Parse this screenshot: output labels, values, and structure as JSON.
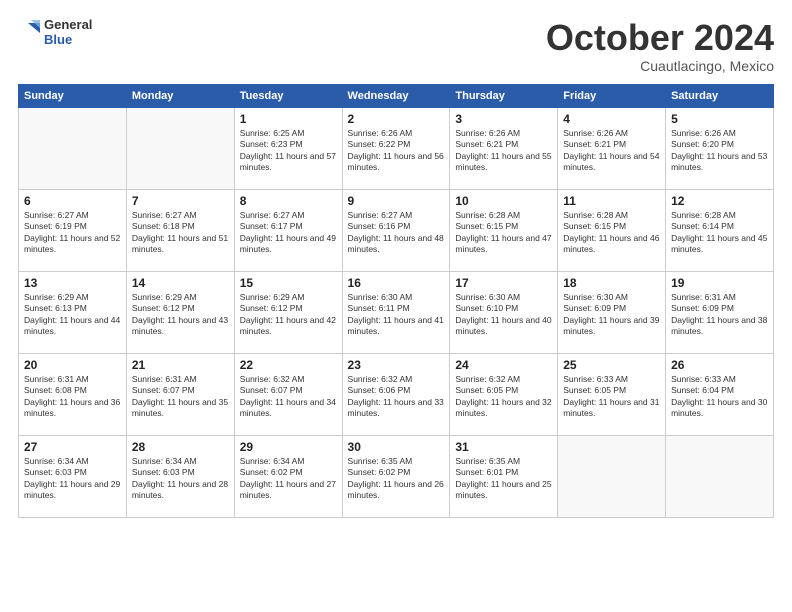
{
  "header": {
    "logo_line1": "General",
    "logo_line2": "Blue",
    "month": "October 2024",
    "location": "Cuautlacingo, Mexico"
  },
  "weekdays": [
    "Sunday",
    "Monday",
    "Tuesday",
    "Wednesday",
    "Thursday",
    "Friday",
    "Saturday"
  ],
  "weeks": [
    [
      {
        "day": "",
        "sunrise": "",
        "sunset": "",
        "daylight": ""
      },
      {
        "day": "",
        "sunrise": "",
        "sunset": "",
        "daylight": ""
      },
      {
        "day": "1",
        "sunrise": "Sunrise: 6:25 AM",
        "sunset": "Sunset: 6:23 PM",
        "daylight": "Daylight: 11 hours and 57 minutes."
      },
      {
        "day": "2",
        "sunrise": "Sunrise: 6:26 AM",
        "sunset": "Sunset: 6:22 PM",
        "daylight": "Daylight: 11 hours and 56 minutes."
      },
      {
        "day": "3",
        "sunrise": "Sunrise: 6:26 AM",
        "sunset": "Sunset: 6:21 PM",
        "daylight": "Daylight: 11 hours and 55 minutes."
      },
      {
        "day": "4",
        "sunrise": "Sunrise: 6:26 AM",
        "sunset": "Sunset: 6:21 PM",
        "daylight": "Daylight: 11 hours and 54 minutes."
      },
      {
        "day": "5",
        "sunrise": "Sunrise: 6:26 AM",
        "sunset": "Sunset: 6:20 PM",
        "daylight": "Daylight: 11 hours and 53 minutes."
      }
    ],
    [
      {
        "day": "6",
        "sunrise": "Sunrise: 6:27 AM",
        "sunset": "Sunset: 6:19 PM",
        "daylight": "Daylight: 11 hours and 52 minutes."
      },
      {
        "day": "7",
        "sunrise": "Sunrise: 6:27 AM",
        "sunset": "Sunset: 6:18 PM",
        "daylight": "Daylight: 11 hours and 51 minutes."
      },
      {
        "day": "8",
        "sunrise": "Sunrise: 6:27 AM",
        "sunset": "Sunset: 6:17 PM",
        "daylight": "Daylight: 11 hours and 49 minutes."
      },
      {
        "day": "9",
        "sunrise": "Sunrise: 6:27 AM",
        "sunset": "Sunset: 6:16 PM",
        "daylight": "Daylight: 11 hours and 48 minutes."
      },
      {
        "day": "10",
        "sunrise": "Sunrise: 6:28 AM",
        "sunset": "Sunset: 6:15 PM",
        "daylight": "Daylight: 11 hours and 47 minutes."
      },
      {
        "day": "11",
        "sunrise": "Sunrise: 6:28 AM",
        "sunset": "Sunset: 6:15 PM",
        "daylight": "Daylight: 11 hours and 46 minutes."
      },
      {
        "day": "12",
        "sunrise": "Sunrise: 6:28 AM",
        "sunset": "Sunset: 6:14 PM",
        "daylight": "Daylight: 11 hours and 45 minutes."
      }
    ],
    [
      {
        "day": "13",
        "sunrise": "Sunrise: 6:29 AM",
        "sunset": "Sunset: 6:13 PM",
        "daylight": "Daylight: 11 hours and 44 minutes."
      },
      {
        "day": "14",
        "sunrise": "Sunrise: 6:29 AM",
        "sunset": "Sunset: 6:12 PM",
        "daylight": "Daylight: 11 hours and 43 minutes."
      },
      {
        "day": "15",
        "sunrise": "Sunrise: 6:29 AM",
        "sunset": "Sunset: 6:12 PM",
        "daylight": "Daylight: 11 hours and 42 minutes."
      },
      {
        "day": "16",
        "sunrise": "Sunrise: 6:30 AM",
        "sunset": "Sunset: 6:11 PM",
        "daylight": "Daylight: 11 hours and 41 minutes."
      },
      {
        "day": "17",
        "sunrise": "Sunrise: 6:30 AM",
        "sunset": "Sunset: 6:10 PM",
        "daylight": "Daylight: 11 hours and 40 minutes."
      },
      {
        "day": "18",
        "sunrise": "Sunrise: 6:30 AM",
        "sunset": "Sunset: 6:09 PM",
        "daylight": "Daylight: 11 hours and 39 minutes."
      },
      {
        "day": "19",
        "sunrise": "Sunrise: 6:31 AM",
        "sunset": "Sunset: 6:09 PM",
        "daylight": "Daylight: 11 hours and 38 minutes."
      }
    ],
    [
      {
        "day": "20",
        "sunrise": "Sunrise: 6:31 AM",
        "sunset": "Sunset: 6:08 PM",
        "daylight": "Daylight: 11 hours and 36 minutes."
      },
      {
        "day": "21",
        "sunrise": "Sunrise: 6:31 AM",
        "sunset": "Sunset: 6:07 PM",
        "daylight": "Daylight: 11 hours and 35 minutes."
      },
      {
        "day": "22",
        "sunrise": "Sunrise: 6:32 AM",
        "sunset": "Sunset: 6:07 PM",
        "daylight": "Daylight: 11 hours and 34 minutes."
      },
      {
        "day": "23",
        "sunrise": "Sunrise: 6:32 AM",
        "sunset": "Sunset: 6:06 PM",
        "daylight": "Daylight: 11 hours and 33 minutes."
      },
      {
        "day": "24",
        "sunrise": "Sunrise: 6:32 AM",
        "sunset": "Sunset: 6:05 PM",
        "daylight": "Daylight: 11 hours and 32 minutes."
      },
      {
        "day": "25",
        "sunrise": "Sunrise: 6:33 AM",
        "sunset": "Sunset: 6:05 PM",
        "daylight": "Daylight: 11 hours and 31 minutes."
      },
      {
        "day": "26",
        "sunrise": "Sunrise: 6:33 AM",
        "sunset": "Sunset: 6:04 PM",
        "daylight": "Daylight: 11 hours and 30 minutes."
      }
    ],
    [
      {
        "day": "27",
        "sunrise": "Sunrise: 6:34 AM",
        "sunset": "Sunset: 6:03 PM",
        "daylight": "Daylight: 11 hours and 29 minutes."
      },
      {
        "day": "28",
        "sunrise": "Sunrise: 6:34 AM",
        "sunset": "Sunset: 6:03 PM",
        "daylight": "Daylight: 11 hours and 28 minutes."
      },
      {
        "day": "29",
        "sunrise": "Sunrise: 6:34 AM",
        "sunset": "Sunset: 6:02 PM",
        "daylight": "Daylight: 11 hours and 27 minutes."
      },
      {
        "day": "30",
        "sunrise": "Sunrise: 6:35 AM",
        "sunset": "Sunset: 6:02 PM",
        "daylight": "Daylight: 11 hours and 26 minutes."
      },
      {
        "day": "31",
        "sunrise": "Sunrise: 6:35 AM",
        "sunset": "Sunset: 6:01 PM",
        "daylight": "Daylight: 11 hours and 25 minutes."
      },
      {
        "day": "",
        "sunrise": "",
        "sunset": "",
        "daylight": ""
      },
      {
        "day": "",
        "sunrise": "",
        "sunset": "",
        "daylight": ""
      }
    ]
  ]
}
